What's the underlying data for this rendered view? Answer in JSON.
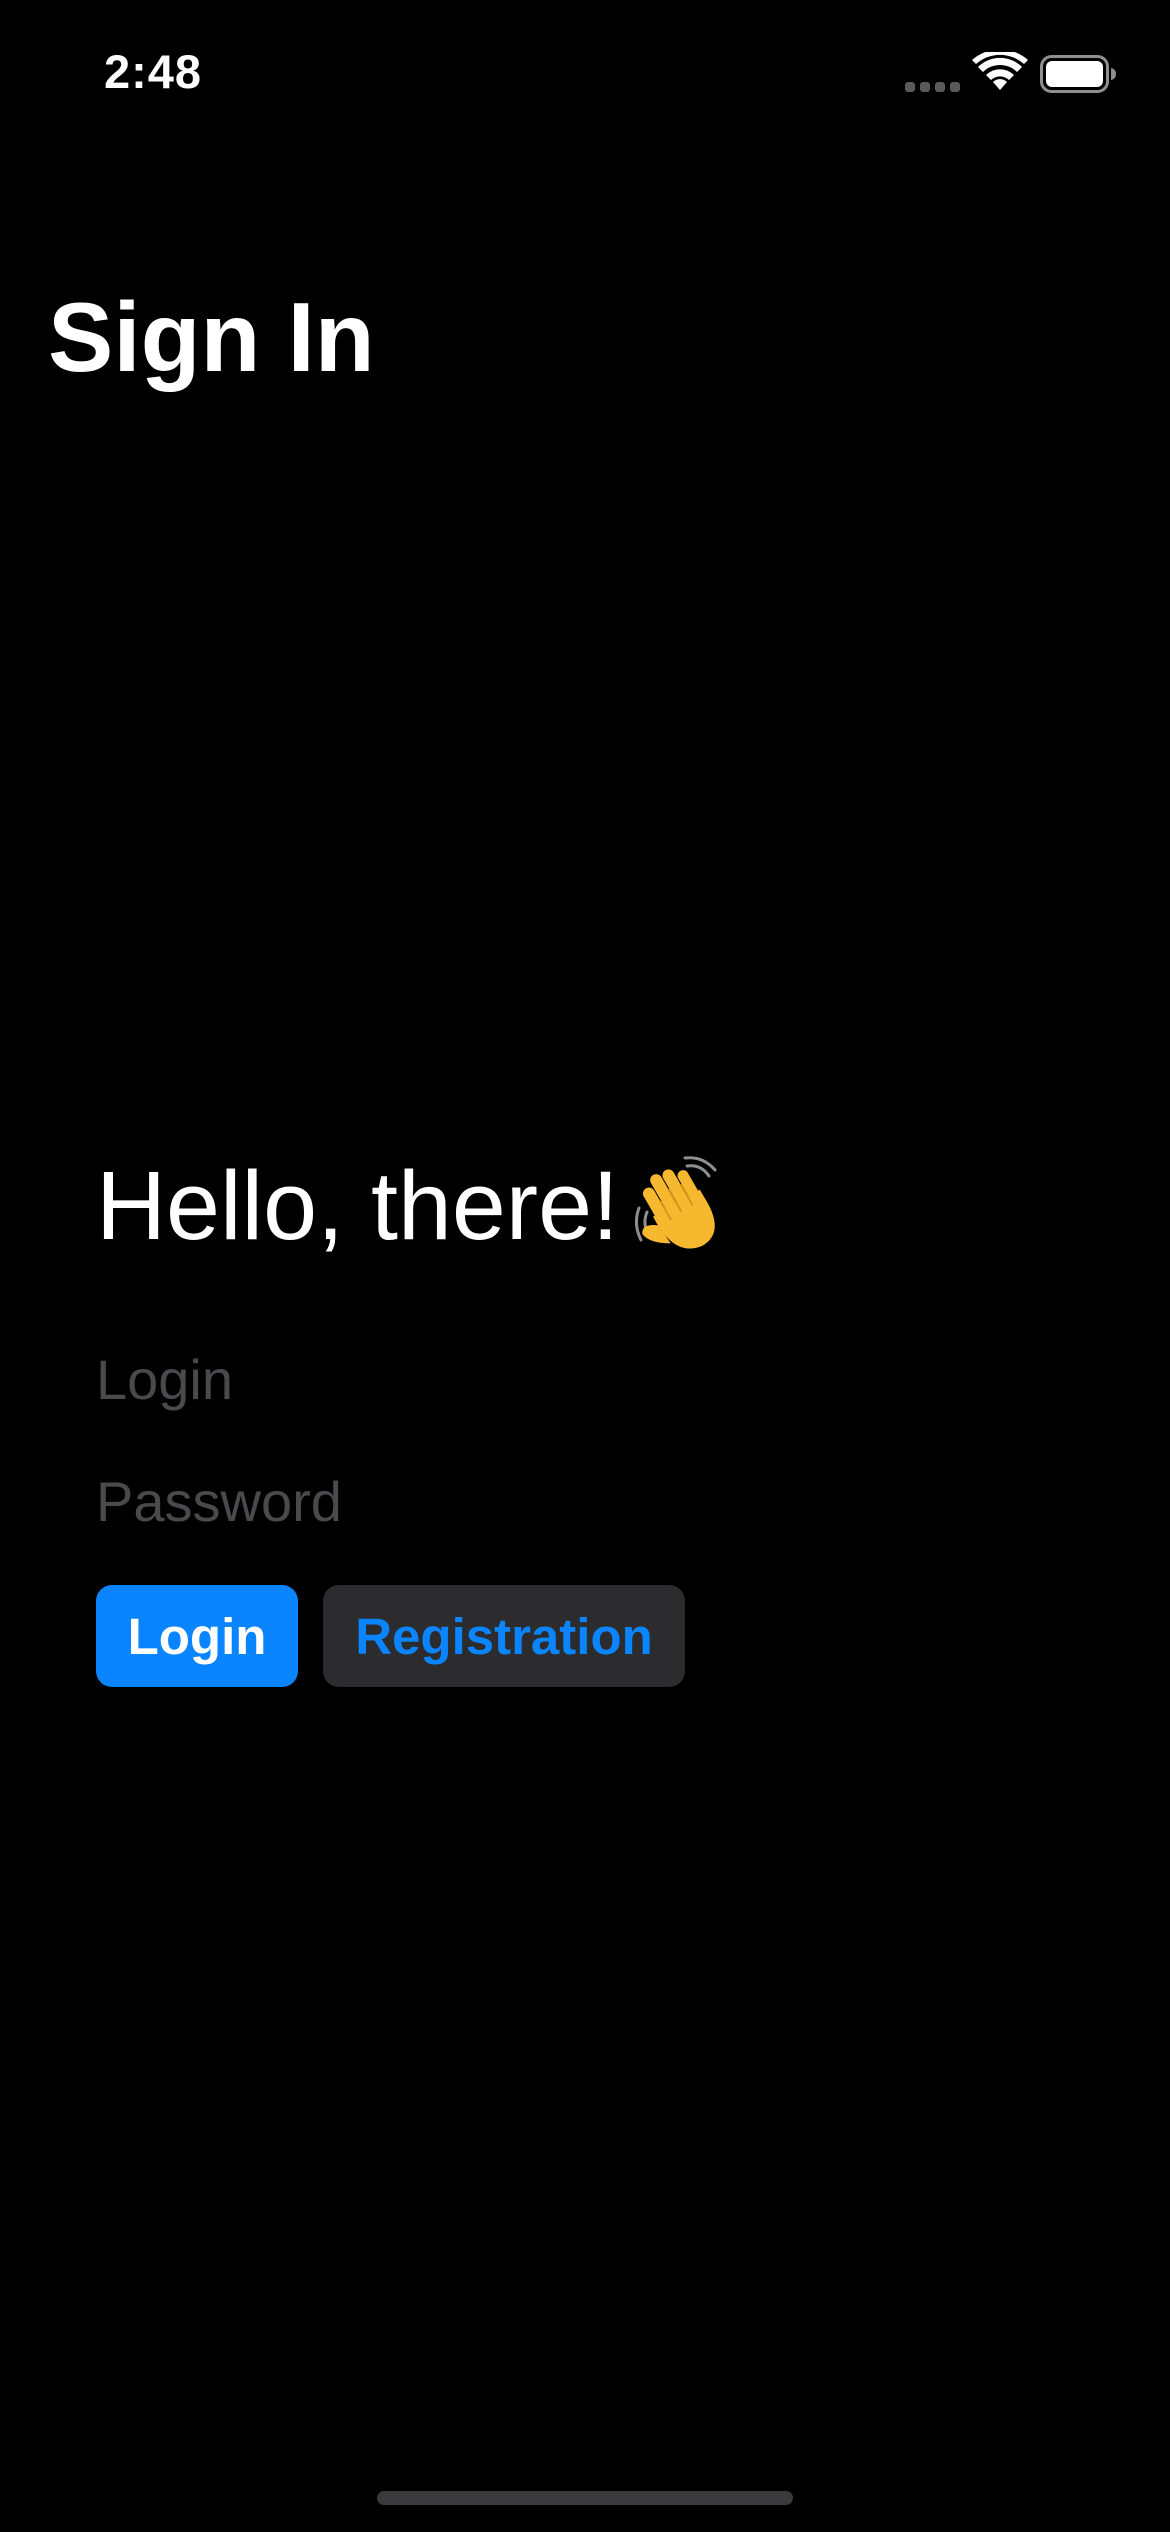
{
  "status_bar": {
    "time": "2:48"
  },
  "nav": {
    "title": "Sign In"
  },
  "greeting": {
    "text": "Hello, there!",
    "icon": "waving-hand-icon"
  },
  "form": {
    "login_placeholder": "Login",
    "login_value": "",
    "password_placeholder": "Password",
    "password_value": ""
  },
  "buttons": {
    "login_label": "Login",
    "registration_label": "Registration"
  },
  "colors": {
    "background": "#000000",
    "accent": "#0a84ff",
    "secondary_button": "#2c2c2e",
    "placeholder": "#4a4a4c",
    "text": "#ffffff"
  }
}
